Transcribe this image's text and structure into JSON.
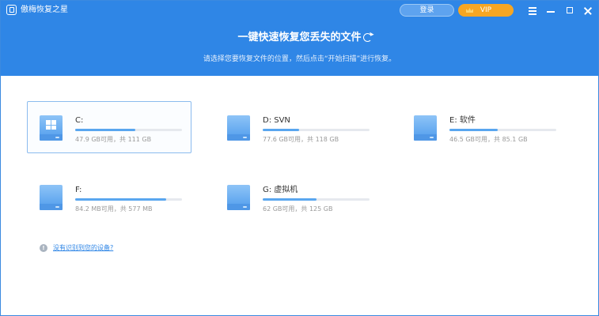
{
  "app": {
    "name": "傲梅恢复之星",
    "logo_icon": "app-logo-icon"
  },
  "titlebar": {
    "login_label": "登录",
    "vip_label": "VIP",
    "vip_icon": "crown-icon",
    "controls": [
      "menu-icon",
      "minimize-icon",
      "maximize-icon",
      "close-icon"
    ]
  },
  "header": {
    "title": "一键快速恢复您丢失的文件",
    "refresh_icon": "refresh-icon",
    "subtitle": "请选择您要恢复文件的位置，然后点击“开始扫描”进行恢复。"
  },
  "drives": [
    {
      "name": "C:",
      "size_text": "47.9 GB可用，共 111 GB",
      "used_fraction": 0.56,
      "selected": true,
      "icon": "windows-drive-icon"
    },
    {
      "name": "D: SVN",
      "size_text": "77.6 GB可用，共 118 GB",
      "used_fraction": 0.34,
      "selected": false,
      "icon": "drive-icon"
    },
    {
      "name": "E: 软件",
      "size_text": "46.5 GB可用，共 85.1 GB",
      "used_fraction": 0.45,
      "selected": false,
      "icon": "drive-icon"
    },
    {
      "name": "F:",
      "size_text": "84.2 MB可用，共 577 MB",
      "used_fraction": 0.85,
      "selected": false,
      "icon": "drive-icon"
    },
    {
      "name": "G: 虚拟机",
      "size_text": "62 GB可用，共 125 GB",
      "used_fraction": 0.5,
      "selected": false,
      "icon": "drive-icon"
    }
  ],
  "help": {
    "icon": "info-icon",
    "link_text": "没有识别到您的设备?"
  },
  "colors": {
    "header_bg": "#2f86e6",
    "vip": "#f6a623",
    "progress": "#59a6ef"
  }
}
